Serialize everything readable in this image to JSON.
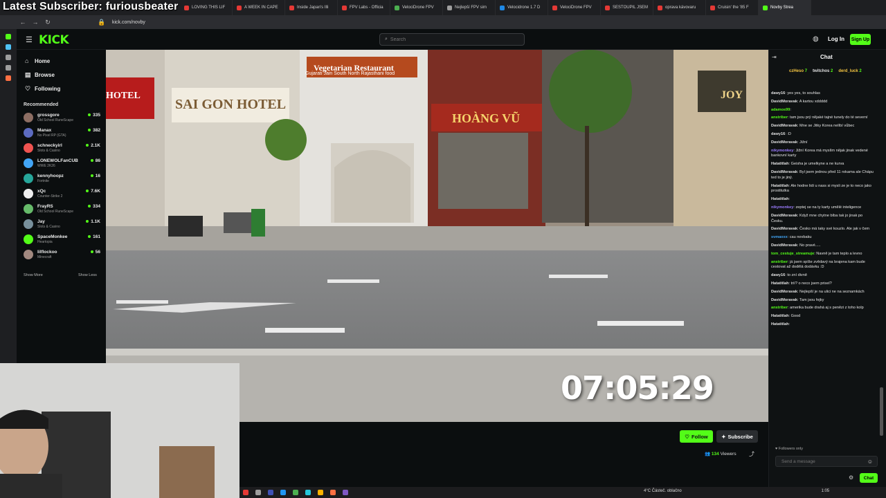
{
  "overlay": {
    "title": "Latest Subscriber: furiousbeater"
  },
  "browser": {
    "tabs": [
      {
        "label": "LOVING THIS LIF",
        "color": "#e53935"
      },
      {
        "label": "A WEEK IN CAPE",
        "color": "#e53935"
      },
      {
        "label": "Inside Japan's Illi",
        "color": "#e53935"
      },
      {
        "label": "FPV Labs - Officia",
        "color": "#e53935"
      },
      {
        "label": "VelociDrone FPV",
        "color": "#4caf50"
      },
      {
        "label": "Nejlepší FPV sim",
        "color": "#9e9e9e"
      },
      {
        "label": "Velocidrone 1.7 D",
        "color": "#1e88e5"
      },
      {
        "label": "VelociDrone FPV",
        "color": "#e53935"
      },
      {
        "label": "SESTOUPIL JSEM",
        "color": "#e53935"
      },
      {
        "label": "oprava kávovaru",
        "color": "#e53935"
      },
      {
        "label": "Cruisin' the '85 F",
        "color": "#e53935"
      },
      {
        "label": "Novby Strea",
        "color": "#53fc18"
      }
    ],
    "url": "kick.com/novby"
  },
  "kick": {
    "logo": "KICK",
    "search_placeholder": "Search",
    "login": "Log In",
    "signup": "Sign Up",
    "nav": {
      "home": "Home",
      "browse": "Browse",
      "following": "Following"
    },
    "recommended_title": "Recommended",
    "channels": [
      {
        "name": "grossgore",
        "category": "Old School RuneScape",
        "viewers": "335",
        "color": "#8d6e63"
      },
      {
        "name": "Manax",
        "category": "No Pixel RP (GTA)",
        "viewers": "382",
        "color": "#5c6bc0"
      },
      {
        "name": "schneckyirl",
        "category": "Slots & Casino",
        "viewers": "2.1K",
        "color": "#ef5350"
      },
      {
        "name": "LONEWOLFanCUB",
        "category": "WWE 2K26",
        "viewers": "86",
        "color": "#42a5f5"
      },
      {
        "name": "kennyhoopz",
        "category": "Fortnite",
        "viewers": "16",
        "color": "#26a69a"
      },
      {
        "name": "xQc",
        "category": "Counter-Strike 2",
        "viewers": "7.6K",
        "color": "#eeeeee"
      },
      {
        "name": "FrayRS",
        "category": "Old School RuneScape",
        "viewers": "334",
        "color": "#66bb6a"
      },
      {
        "name": "Jay",
        "category": "Slots & Casino",
        "viewers": "1.1K",
        "color": "#78909c"
      },
      {
        "name": "SpaceMonkee",
        "category": "Heartopia",
        "viewers": "161",
        "color": "#53fc18"
      },
      {
        "name": "lilflockoo",
        "category": "Minecraft",
        "viewers": "56",
        "color": "#a1887f"
      }
    ],
    "show_more": "Show More",
    "show_less": "Show Less",
    "timer": "07:05:29",
    "follow": "Follow",
    "subscribe": "Subscribe",
    "viewers_count": "134",
    "viewers_label": "Viewers"
  },
  "chat": {
    "title": "Chat",
    "pinned": [
      {
        "name": "czHeso",
        "count": "7",
        "color": "#f5c542"
      },
      {
        "name": "twitchos",
        "count": "2",
        "color": "#e0e0e0"
      },
      {
        "name": "derd_luck",
        "count": "2",
        "color": "#f5c542"
      }
    ],
    "messages": [
      {
        "user": "dawy16",
        "text": "yes yes, to souhlas",
        "color": "#e0e0e0"
      },
      {
        "user": "DavidMoravak",
        "text": "A kartou xddddd",
        "color": "#e0e0e0"
      },
      {
        "user": "adamos99",
        "text": "",
        "color": "#53fc18"
      },
      {
        "user": "anstriber",
        "text": "tam jsou prý nějaké tajné tunely do té severní",
        "color": "#53fc18"
      },
      {
        "user": "DavidMoravak",
        "text": "Mne se Jitky Korea nelíbí vůbec",
        "color": "#e0e0e0"
      },
      {
        "user": "dawy16",
        "text": ":D",
        "color": "#e0e0e0"
      },
      {
        "user": "DavidMoravak",
        "text": "Jižní",
        "color": "#e0e0e0"
      },
      {
        "user": "nikymonkey",
        "text": "Jižní Korea má myslím nějak jinak vedené bankovní karty",
        "color": "#9c7cff"
      },
      {
        "user": "Hatatitlah",
        "text": "Geisha je umelkyne a ne kurva",
        "color": "#e0e0e0"
      },
      {
        "user": "DavidMoravak",
        "text": "Byl jsem jednou před 11 rokama ale Chápu ted to je jiný.",
        "color": "#e0e0e0"
      },
      {
        "user": "Hatatitlah",
        "text": "Ale hodne lidi u nass si mysli ze je to neco jako prostitutka",
        "color": "#e0e0e0"
      },
      {
        "user": "Hatatitlah",
        "text": "",
        "color": "#e0e0e0"
      },
      {
        "user": "nikymonkey",
        "text": "zeptej se na ty karty umělé inteligence",
        "color": "#9c7cff"
      },
      {
        "user": "DavidMoravak",
        "text": "Když mne chytne bíba tak jo jinak po Česku.",
        "color": "#e0e0e0"
      },
      {
        "user": "DavidMoravak",
        "text": "Česko má taky své kouzlo. Ale jak v čem",
        "color": "#e0e0e0"
      },
      {
        "user": "svmaxxx",
        "text": "cau novbaku",
        "color": "#42a5f5"
      },
      {
        "user": "DavidMoravak",
        "text": "No pravé.....",
        "color": "#e0e0e0"
      },
      {
        "user": "tom_cestuje_streamuje",
        "text": "Navně je tam teplo a levno",
        "color": "#53fc18"
      },
      {
        "user": "anstriber",
        "text": "já jsem spíše zvědavý na brajena kam bude cestovat až dodělá dodávku :D",
        "color": "#53fc18"
      },
      {
        "user": "dawy16",
        "text": "to zní divně",
        "color": "#e0e0e0"
      },
      {
        "user": "Hatatitlah",
        "text": "trií? o neco jsem prisel?",
        "color": "#e0e0e0"
      },
      {
        "user": "DavidMoravak",
        "text": "Nejlepší je na ulici ne na seznamkách",
        "color": "#e0e0e0"
      },
      {
        "user": "DavidMoravak",
        "text": "Tam jsou fejky",
        "color": "#e0e0e0"
      },
      {
        "user": "anstriber",
        "text": "amerika bude drahá aj s penězi z toho kolp",
        "color": "#53fc18"
      },
      {
        "user": "Hatatitlah",
        "text": "Good",
        "color": "#e0e0e0"
      },
      {
        "user": "Hatatitlah",
        "text": "",
        "color": "#e0e0e0"
      }
    ],
    "followers_only": "Followers only",
    "send_placeholder": "Send a message",
    "chat_button": "Chat"
  },
  "taskbar": {
    "weather": "4°C  Částeč. oblačno",
    "time": "1:05"
  },
  "video_scene": {
    "sign_hotel": "SAI GON HOTEL",
    "sign_hotel_small": "HOTEL",
    "sign_hoang_vu": "HOÀNG VŨ",
    "sign_veg": "Vegetarian Restaurant",
    "sign_veg2": "Gujarati  Jain  South  North  Rajasthani food",
    "sign_joy": "JOY"
  }
}
